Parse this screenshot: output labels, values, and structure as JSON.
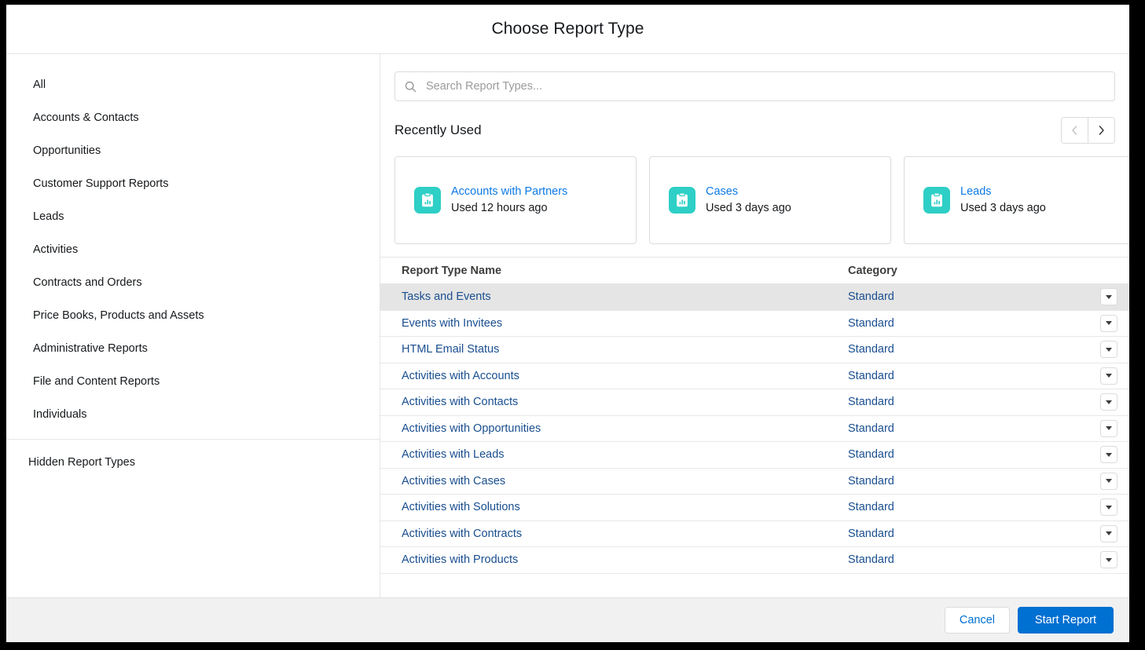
{
  "header": {
    "title": "Choose Report Type"
  },
  "sidebar": {
    "items": [
      {
        "label": "All"
      },
      {
        "label": "Accounts & Contacts"
      },
      {
        "label": "Opportunities"
      },
      {
        "label": "Customer Support Reports"
      },
      {
        "label": "Leads"
      },
      {
        "label": "Activities"
      },
      {
        "label": "Contracts and Orders"
      },
      {
        "label": "Price Books, Products and Assets"
      },
      {
        "label": "Administrative Reports"
      },
      {
        "label": "File and Content Reports"
      },
      {
        "label": "Individuals"
      }
    ],
    "hidden_label": "Hidden Report Types"
  },
  "search": {
    "placeholder": "Search Report Types...",
    "value": "",
    "icon": "search-icon"
  },
  "recent": {
    "title": "Recently Used",
    "prev_icon": "chevron-left-icon",
    "next_icon": "chevron-right-icon",
    "cards": [
      {
        "name": "Accounts with Partners",
        "meta": "Used 12 hours ago",
        "icon": "report-clipboard-icon"
      },
      {
        "name": "Cases",
        "meta": "Used 3 days ago",
        "icon": "report-clipboard-icon"
      },
      {
        "name": "Leads",
        "meta": "Used 3 days ago",
        "icon": "report-clipboard-icon"
      }
    ]
  },
  "table": {
    "columns": [
      "Report Type Name",
      "Category"
    ],
    "rows": [
      {
        "name": "Tasks and Events",
        "category": "Standard",
        "selected": true
      },
      {
        "name": "Events with Invitees",
        "category": "Standard",
        "selected": false
      },
      {
        "name": "HTML Email Status",
        "category": "Standard",
        "selected": false
      },
      {
        "name": "Activities with Accounts",
        "category": "Standard",
        "selected": false
      },
      {
        "name": "Activities with Contacts",
        "category": "Standard",
        "selected": false
      },
      {
        "name": "Activities with Opportunities",
        "category": "Standard",
        "selected": false
      },
      {
        "name": "Activities with Leads",
        "category": "Standard",
        "selected": false
      },
      {
        "name": "Activities with Cases",
        "category": "Standard",
        "selected": false
      },
      {
        "name": "Activities with Solutions",
        "category": "Standard",
        "selected": false
      },
      {
        "name": "Activities with Contracts",
        "category": "Standard",
        "selected": false
      },
      {
        "name": "Activities with Products",
        "category": "Standard",
        "selected": false
      }
    ],
    "row_menu_icon": "chevron-down-icon"
  },
  "footer": {
    "cancel_label": "Cancel",
    "start_label": "Start Report"
  },
  "colors": {
    "primary": "#0070d2",
    "link": "#194e8f",
    "card_link": "#0d7ae5",
    "icon_teal": "#2ecfc6",
    "selected_row": "#e5e5e5",
    "footer_bg": "#f1f1f1"
  }
}
